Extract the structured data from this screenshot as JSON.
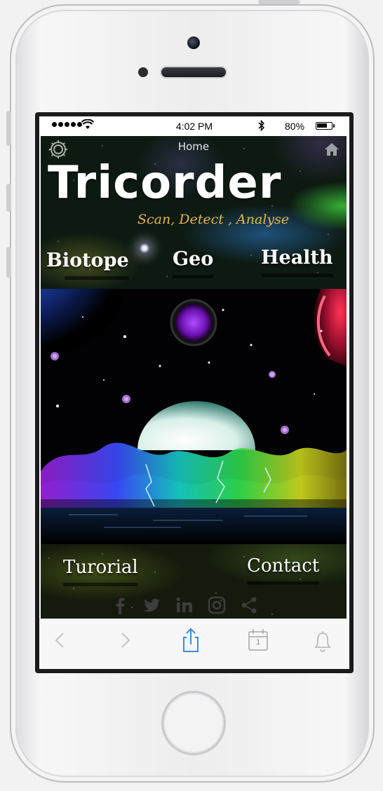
{
  "status_bar": {
    "time": "4:02 PM",
    "battery_percent": "80%",
    "battery_level": 0.8,
    "signal_dots": 5
  },
  "app": {
    "home_label": "Home",
    "title": "Tricorder",
    "tagline": "Scan, Detect , Analyse",
    "nav": {
      "biotope": "Biotope",
      "geo": "Geo",
      "health": "Health"
    },
    "bottom_nav": {
      "tutorial": "Turorial",
      "contact": "Contact"
    },
    "social_icons": [
      "facebook-icon",
      "twitter-icon",
      "linkedin-icon",
      "instagram-icon",
      "share-icon"
    ],
    "colors": {
      "title": "#ffffff",
      "tagline": "#e8b54a",
      "toolbar_accent": "#3b8be6"
    }
  },
  "toolbar": {
    "calendar_day": "1",
    "icons": [
      "back-arrow-icon",
      "forward-arrow-icon",
      "share-upload-icon",
      "calendar-icon",
      "bell-icon"
    ]
  }
}
